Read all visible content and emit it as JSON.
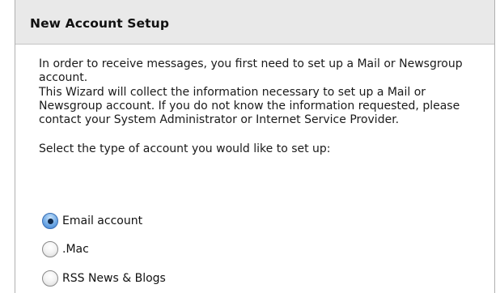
{
  "dialog": {
    "title": "New Account Setup",
    "paragraphs": {
      "intro": "In order to receive messages, you first need to set up a Mail or Newsgroup account.",
      "wizard": "This Wizard will collect the information necessary to set up a Mail or Newsgroup account. If you do not know the information requested, please contact your System Administrator or Internet Service Provider.",
      "prompt": "Select the type of account you would like to set up:"
    },
    "account_types": {
      "selected": "Email account",
      "options": [
        {
          "label": "Email account",
          "checked": true
        },
        {
          "label": ".Mac",
          "checked": false
        },
        {
          "label": "RSS News & Blogs",
          "checked": false
        }
      ]
    }
  }
}
